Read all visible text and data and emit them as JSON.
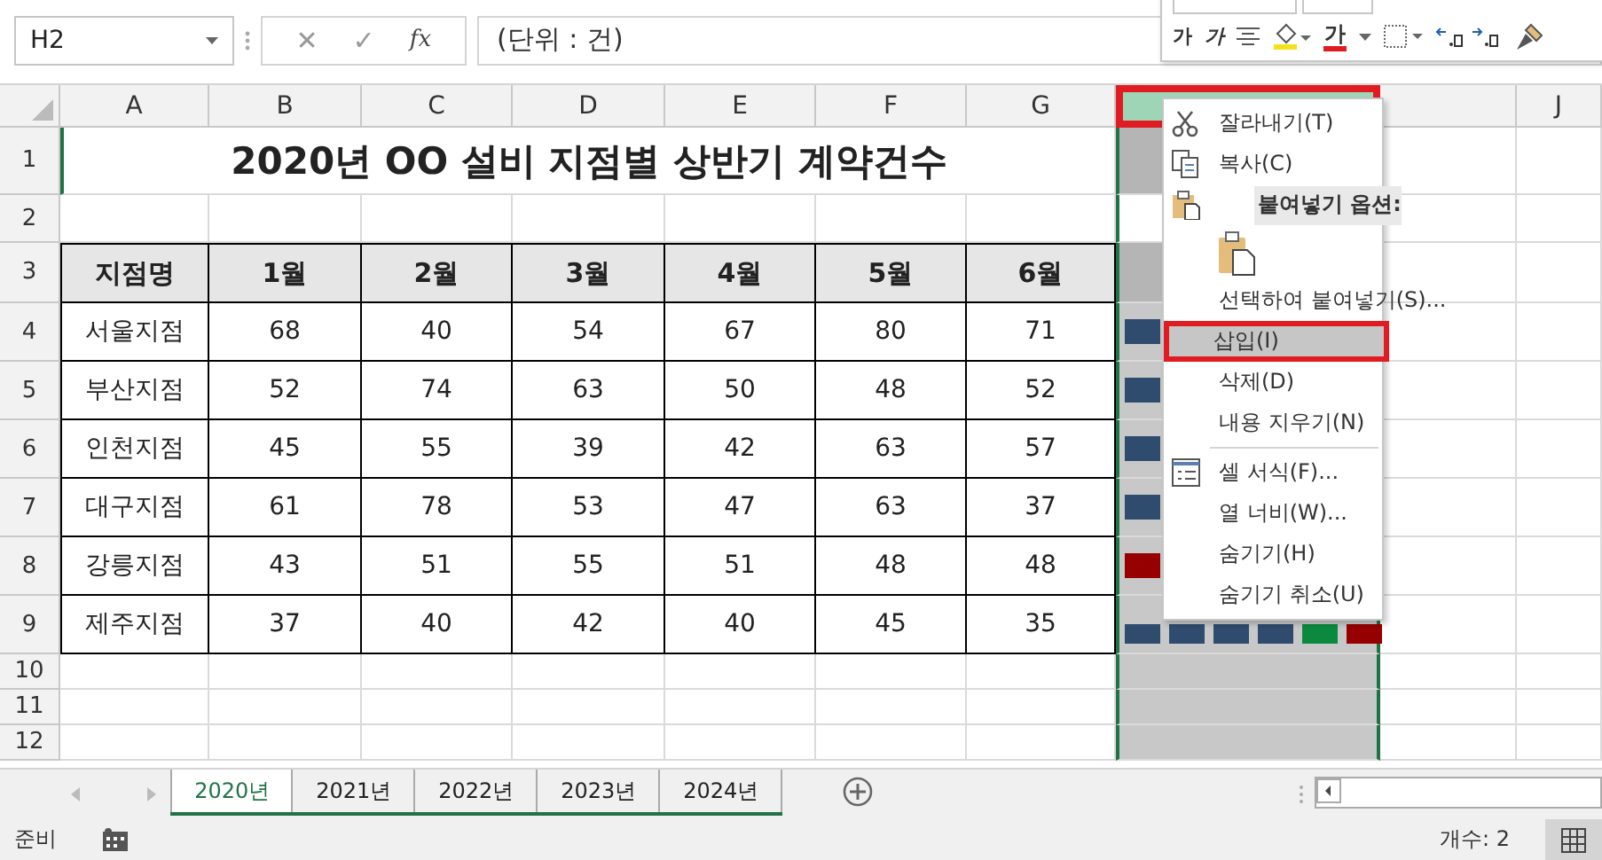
{
  "name_box": "H2",
  "formula_buttons": [
    "✕",
    "✓",
    "fx"
  ],
  "formula": "(단위 : 건)",
  "mini_toolbar": [
    {
      "kind": "bold",
      "label": "가"
    },
    {
      "kind": "italic",
      "label": "가"
    },
    {
      "kind": "align"
    },
    {
      "kind": "fill"
    },
    {
      "kind": "fontcolor",
      "label": "가"
    },
    {
      "kind": "border"
    },
    {
      "kind": "decimal"
    },
    {
      "kind": "brush"
    }
  ],
  "column_headers": [
    {
      "label": "A",
      "selected": false,
      "highlighted": false
    },
    {
      "label": "B",
      "selected": false,
      "highlighted": false
    },
    {
      "label": "C",
      "selected": false,
      "highlighted": false
    },
    {
      "label": "D",
      "selected": false,
      "highlighted": false
    },
    {
      "label": "E",
      "selected": false,
      "highlighted": false
    },
    {
      "label": "F",
      "selected": false,
      "highlighted": false
    },
    {
      "label": "G",
      "selected": false,
      "highlighted": false
    },
    {
      "selected": true,
      "highlighted": true
    },
    {
      "selected": false,
      "highlighted": false
    },
    {
      "label": "J",
      "selected": false,
      "highlighted": false
    }
  ],
  "row_headers": [
    "1",
    "2",
    "3",
    "4",
    "5",
    "6",
    "7",
    "8",
    "9",
    "10",
    "11",
    "12"
  ],
  "title": "2020년 OO 설비 지점별 상반기 계약건수",
  "table_header": [
    "지점명",
    "1월",
    "2월",
    "3월",
    "4월",
    "5월",
    "6월"
  ],
  "table_rows": [
    {
      "cells": [
        "서울지점",
        "68",
        "40",
        "54",
        "67",
        "80",
        "71"
      ],
      "marks": [
        {
          "color": "#2f4b6e"
        }
      ]
    },
    {
      "cells": [
        "부산지점",
        "52",
        "74",
        "63",
        "50",
        "48",
        "52"
      ],
      "marks": [
        {
          "color": "#2f4b6e"
        }
      ]
    },
    {
      "cells": [
        "인천지점",
        "45",
        "55",
        "39",
        "42",
        "63",
        "57"
      ],
      "marks": [
        {
          "color": "#2f4b6e"
        }
      ]
    },
    {
      "cells": [
        "대구지점",
        "61",
        "78",
        "53",
        "47",
        "63",
        "37"
      ],
      "marks": [
        {
          "color": "#2f4b6e"
        }
      ]
    },
    {
      "cells": [
        "강릉지점",
        "43",
        "51",
        "55",
        "51",
        "48",
        "48"
      ],
      "marks": [
        {
          "color": "#960000"
        }
      ]
    },
    {
      "cells": [
        "제주지점",
        "37",
        "40",
        "42",
        "40",
        "45",
        "35"
      ],
      "marks": [
        {
          "color": "#2f4b6e"
        },
        {
          "color": "#2f4b6e"
        },
        {
          "color": "#2f4b6e"
        },
        {
          "color": "#2f4b6e"
        },
        {
          "color": "#0b8a3f"
        },
        {
          "color": "#960000"
        }
      ]
    }
  ],
  "context_menu": [
    {
      "kind": "cut",
      "label": "잘라내기(T)",
      "highlighted": false
    },
    {
      "kind": "copy",
      "label": "복사(C)",
      "highlighted": false
    },
    {
      "kind": "section",
      "label": "붙여넣기 옵션:",
      "highlighted": false
    },
    {
      "kind": "paste"
    },
    {
      "kind": "item",
      "label": "선택하여 붙여넣기(S)...",
      "highlighted": false
    },
    {
      "kind": "item",
      "label": "삽입(I)",
      "highlighted": true
    },
    {
      "kind": "item",
      "label": "삭제(D)",
      "highlighted": false
    },
    {
      "kind": "item",
      "label": "내용 지우기(N)",
      "highlighted": false
    },
    {
      "kind": "separator"
    },
    {
      "kind": "format",
      "label": "셀 서식(F)...",
      "highlighted": false
    },
    {
      "kind": "item",
      "label": "열 너비(W)...",
      "highlighted": false
    },
    {
      "kind": "item",
      "label": "숨기기(H)",
      "highlighted": false
    },
    {
      "kind": "item",
      "label": "숨기기 취소(U)",
      "highlighted": false
    }
  ],
  "sheet_tabs": [
    {
      "label": "2020년",
      "selected": true
    },
    {
      "label": "2021년",
      "selected": false
    },
    {
      "label": "2022년",
      "selected": false
    },
    {
      "label": "2023년",
      "selected": false
    },
    {
      "label": "2024년",
      "selected": false
    }
  ],
  "status_bar": {
    "mode": "준비",
    "count": "개수: 2"
  }
}
